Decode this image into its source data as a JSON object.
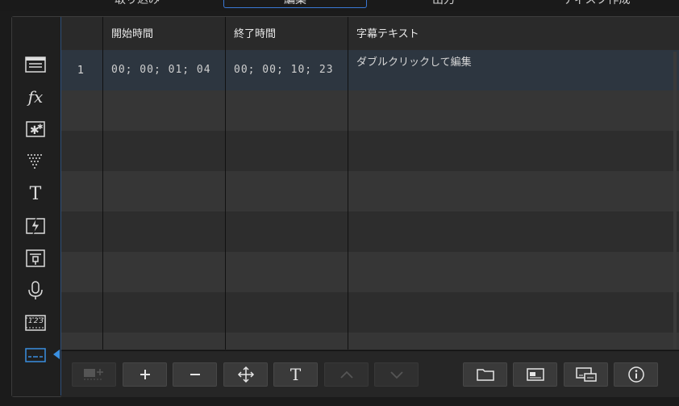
{
  "tabs": [
    {
      "label": "取り込み"
    },
    {
      "label": "編集"
    },
    {
      "label": "出力"
    },
    {
      "label": "ディスク作成"
    }
  ],
  "sidebar": {
    "items": [
      {
        "icon": "media-room-icon"
      },
      {
        "icon": "fx-icon",
        "label": "fx"
      },
      {
        "icon": "pip-objects-icon"
      },
      {
        "icon": "particle-icon"
      },
      {
        "icon": "title-icon",
        "label": "T"
      },
      {
        "icon": "transition-icon"
      },
      {
        "icon": "audio-mixing-icon"
      },
      {
        "icon": "voice-over-icon"
      },
      {
        "icon": "chapter-icon",
        "label": "123"
      },
      {
        "icon": "subtitle-icon",
        "active": true
      }
    ]
  },
  "table": {
    "columns": [
      "開始時間",
      "終了時間",
      "字幕テキスト"
    ],
    "rows": [
      {
        "index": "1",
        "start": "00; 00; 01; 04",
        "end": "00; 00; 10; 23",
        "text": "ダブルクリックして編集"
      }
    ]
  },
  "toolbar": {
    "buttons": [
      {
        "name": "add-subtitle-at-position-button",
        "icon": "film-plus-icon",
        "enabled": false
      },
      {
        "name": "add-subtitle-button",
        "icon": "plus-icon",
        "enabled": true
      },
      {
        "name": "remove-subtitle-button",
        "icon": "minus-icon",
        "enabled": true
      },
      {
        "name": "move-subtitle-button",
        "icon": "move-icon",
        "enabled": true
      },
      {
        "name": "text-format-button",
        "icon": "text-t-icon",
        "label": "T",
        "enabled": true
      },
      {
        "name": "move-up-button",
        "icon": "chevron-up-icon",
        "enabled": false
      },
      {
        "name": "move-down-button",
        "icon": "chevron-down-icon",
        "enabled": false
      },
      {
        "name": "import-subtitle-button",
        "icon": "folder-icon",
        "enabled": true
      },
      {
        "name": "subtitle-position-button",
        "icon": "screen-subtitle-icon",
        "enabled": true
      },
      {
        "name": "subtitle-settings-button",
        "icon": "subtitle-window-icon",
        "enabled": true
      },
      {
        "name": "info-button",
        "icon": "info-icon",
        "enabled": true
      }
    ]
  },
  "colors": {
    "accent": "#3a8fe0",
    "selected_row": "#2d3640"
  }
}
